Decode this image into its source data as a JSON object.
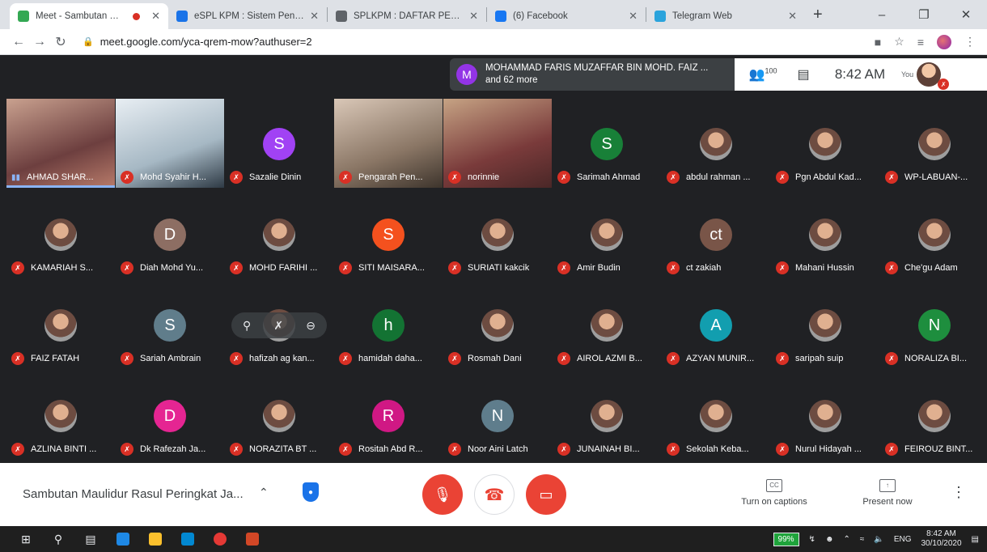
{
  "browser": {
    "tabs": [
      {
        "title": "Meet - Sambutan Maulidu",
        "active": true,
        "recording": true,
        "color": "#34a853"
      },
      {
        "title": "eSPL KPM : Sistem Pengurusan",
        "active": false,
        "recording": false,
        "color": "#1a73e8"
      },
      {
        "title": "SPLKPM : DAFTAR PESERTA LD",
        "active": false,
        "recording": false,
        "color": "#5f6368"
      },
      {
        "title": "(6) Facebook",
        "active": false,
        "recording": false,
        "color": "#1877f2"
      },
      {
        "title": "Telegram Web",
        "active": false,
        "recording": false,
        "color": "#2aa3dc"
      }
    ],
    "url": "meet.google.com/yca-qrem-mow?authuser=2"
  },
  "meet": {
    "presenter": {
      "initial": "M",
      "name": "MOHAMMAD FARIS MUZAFFAR BIN MOHD. FAIZ ...",
      "more": "and 62 more"
    },
    "people_count": "100",
    "clock": "8:42 AM",
    "you_label": "You",
    "meeting_title": "Sambutan Maulidur Rasul Peringkat Ja...",
    "captions_label": "Turn on captions",
    "captions_icon": "CC",
    "present_label": "Present now"
  },
  "participants": [
    {
      "name": "AHMAD SHAR...",
      "kind": "video",
      "speaking": true
    },
    {
      "name": "Mohd Syahir H...",
      "kind": "video"
    },
    {
      "name": "Sazalie Dinin",
      "kind": "letter",
      "initial": "S",
      "color": "#a142f4"
    },
    {
      "name": "Pengarah Pen...",
      "kind": "video"
    },
    {
      "name": "norinnie",
      "kind": "video"
    },
    {
      "name": "Sarimah Ahmad",
      "kind": "letter",
      "initial": "S",
      "color": "#188038"
    },
    {
      "name": "abdul rahman ...",
      "kind": "photo"
    },
    {
      "name": "Pgn Abdul Kad...",
      "kind": "photo"
    },
    {
      "name": "WP-LABUAN-...",
      "kind": "photo"
    },
    {
      "name": "KAMARIAH S...",
      "kind": "photo"
    },
    {
      "name": "Diah Mohd Yu...",
      "kind": "letter",
      "initial": "D",
      "color": "#8d6e63"
    },
    {
      "name": "MOHD FARIHI ...",
      "kind": "photo"
    },
    {
      "name": "SITI MAISARA...",
      "kind": "letter",
      "initial": "S",
      "color": "#f4511e"
    },
    {
      "name": "SURIATI kakcik",
      "kind": "photo"
    },
    {
      "name": "Amir Budin",
      "kind": "photo"
    },
    {
      "name": "ct zakiah",
      "kind": "letter",
      "initial": "ct",
      "color": "#795548"
    },
    {
      "name": "Mahani Hussin",
      "kind": "photo"
    },
    {
      "name": "Che'gu Adam",
      "kind": "photo"
    },
    {
      "name": "FAIZ FATAH",
      "kind": "photo"
    },
    {
      "name": "Sariah Ambrain",
      "kind": "letter",
      "initial": "S",
      "color": "#607d8b"
    },
    {
      "name": "hafizah ag kan...",
      "kind": "photo",
      "hover": true
    },
    {
      "name": "hamidah daha...",
      "kind": "letter",
      "initial": "h",
      "color": "#137333"
    },
    {
      "name": "Rosmah Dani",
      "kind": "photo"
    },
    {
      "name": "AIROL AZMI B...",
      "kind": "photo"
    },
    {
      "name": "AZYAN MUNIR...",
      "kind": "letter",
      "initial": "A",
      "color": "#129eaf"
    },
    {
      "name": "saripah suip",
      "kind": "photo"
    },
    {
      "name": "NORALIZA BI...",
      "kind": "letter",
      "initial": "N",
      "color": "#1e8e3e"
    },
    {
      "name": "AZLINA BINTI ...",
      "kind": "photo"
    },
    {
      "name": "Dk Rafezah Ja...",
      "kind": "letter",
      "initial": "D",
      "color": "#e52592"
    },
    {
      "name": "NORAZITA BT ...",
      "kind": "photo"
    },
    {
      "name": "Rositah Abd R...",
      "kind": "letter",
      "initial": "R",
      "color": "#d01884"
    },
    {
      "name": "Noor Aini Latch",
      "kind": "letter",
      "initial": "N",
      "color": "#5f7d8c"
    },
    {
      "name": "JUNAINAH BI...",
      "kind": "photo"
    },
    {
      "name": "Sekolah Keba...",
      "kind": "photo"
    },
    {
      "name": "Nurul Hidayah ...",
      "kind": "photo"
    },
    {
      "name": "FEIROUZ BINT...",
      "kind": "photo"
    }
  ],
  "taskbar": {
    "battery": "99%",
    "lang": "ENG",
    "time": "8:42 AM",
    "date": "30/10/2020"
  }
}
